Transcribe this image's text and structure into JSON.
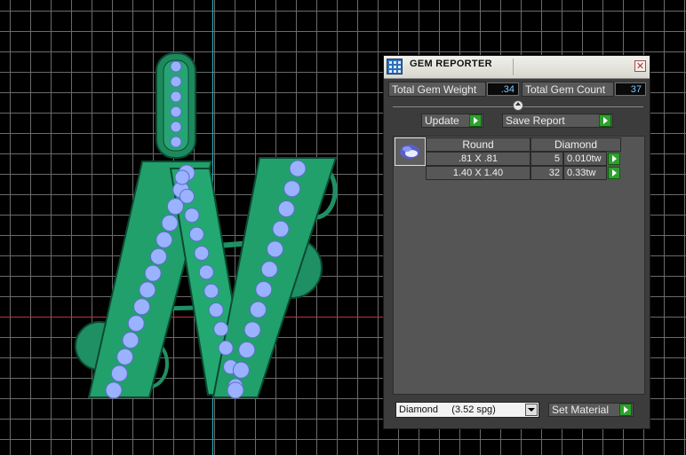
{
  "panel": {
    "title": "GEM REPORTER",
    "close_glyph": "✕",
    "total_weight_label": "Total Gem Weight",
    "total_weight_value": ".34",
    "total_count_label": "Total Gem Count",
    "total_count_value": "37",
    "update_label": "Update",
    "save_label": "Save Report",
    "table": {
      "headers": [
        "Round",
        "Diamond"
      ],
      "rows": [
        {
          "size": ".81 X .81",
          "count": "5",
          "weight": "0.010tw"
        },
        {
          "size": "1.40 X 1.40",
          "count": "32",
          "weight": "0.33tw"
        }
      ]
    },
    "material_selected": "Diamond     (3.52 spg)",
    "set_material_label": "Set Material"
  },
  "colors": {
    "metal": "#2a9a6a",
    "metal_dark": "#0f5a3c",
    "gem": "#9ab2ff",
    "grid": "#777777",
    "axis_y": "#2fb8c8",
    "axis_x": "#c83030"
  }
}
